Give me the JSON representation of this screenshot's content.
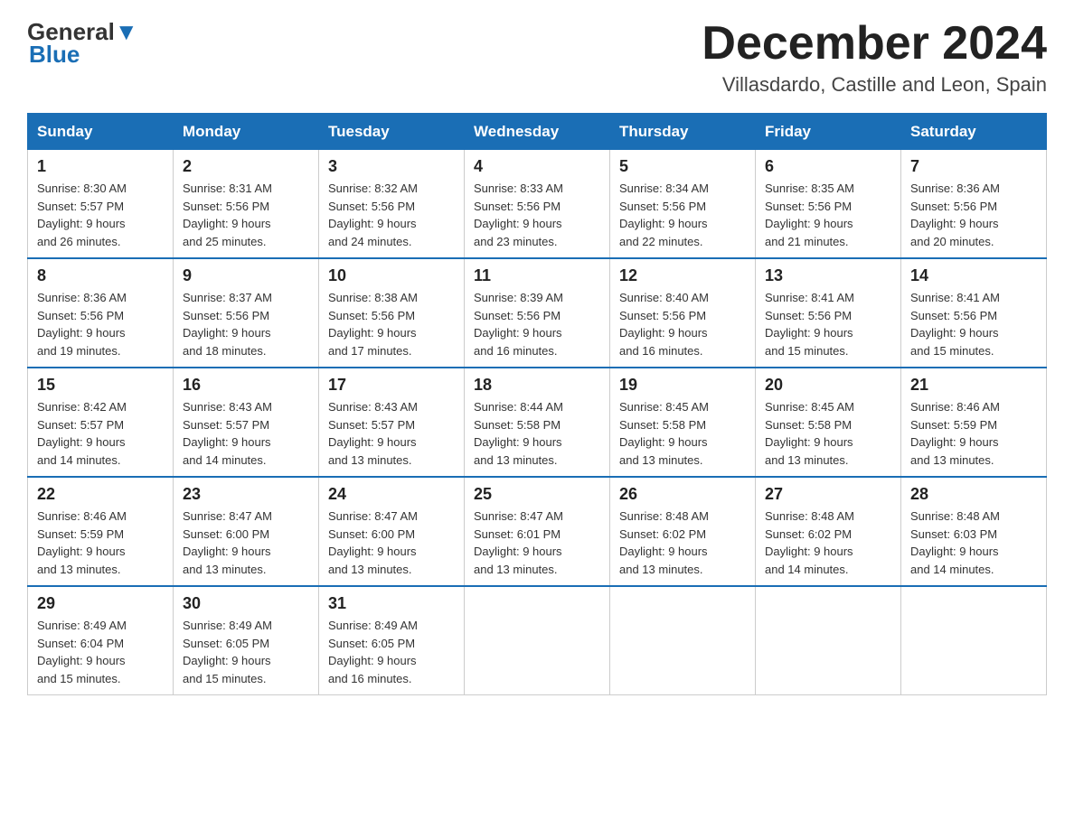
{
  "header": {
    "logo_top": "General",
    "logo_bottom": "Blue",
    "month_title": "December 2024",
    "location": "Villasdardo, Castille and Leon, Spain"
  },
  "days_of_week": [
    "Sunday",
    "Monday",
    "Tuesday",
    "Wednesday",
    "Thursday",
    "Friday",
    "Saturday"
  ],
  "weeks": [
    [
      {
        "day": "1",
        "sunrise": "8:30 AM",
        "sunset": "5:57 PM",
        "daylight": "9 hours and 26 minutes."
      },
      {
        "day": "2",
        "sunrise": "8:31 AM",
        "sunset": "5:56 PM",
        "daylight": "9 hours and 25 minutes."
      },
      {
        "day": "3",
        "sunrise": "8:32 AM",
        "sunset": "5:56 PM",
        "daylight": "9 hours and 24 minutes."
      },
      {
        "day": "4",
        "sunrise": "8:33 AM",
        "sunset": "5:56 PM",
        "daylight": "9 hours and 23 minutes."
      },
      {
        "day": "5",
        "sunrise": "8:34 AM",
        "sunset": "5:56 PM",
        "daylight": "9 hours and 22 minutes."
      },
      {
        "day": "6",
        "sunrise": "8:35 AM",
        "sunset": "5:56 PM",
        "daylight": "9 hours and 21 minutes."
      },
      {
        "day": "7",
        "sunrise": "8:36 AM",
        "sunset": "5:56 PM",
        "daylight": "9 hours and 20 minutes."
      }
    ],
    [
      {
        "day": "8",
        "sunrise": "8:36 AM",
        "sunset": "5:56 PM",
        "daylight": "9 hours and 19 minutes."
      },
      {
        "day": "9",
        "sunrise": "8:37 AM",
        "sunset": "5:56 PM",
        "daylight": "9 hours and 18 minutes."
      },
      {
        "day": "10",
        "sunrise": "8:38 AM",
        "sunset": "5:56 PM",
        "daylight": "9 hours and 17 minutes."
      },
      {
        "day": "11",
        "sunrise": "8:39 AM",
        "sunset": "5:56 PM",
        "daylight": "9 hours and 16 minutes."
      },
      {
        "day": "12",
        "sunrise": "8:40 AM",
        "sunset": "5:56 PM",
        "daylight": "9 hours and 16 minutes."
      },
      {
        "day": "13",
        "sunrise": "8:41 AM",
        "sunset": "5:56 PM",
        "daylight": "9 hours and 15 minutes."
      },
      {
        "day": "14",
        "sunrise": "8:41 AM",
        "sunset": "5:56 PM",
        "daylight": "9 hours and 15 minutes."
      }
    ],
    [
      {
        "day": "15",
        "sunrise": "8:42 AM",
        "sunset": "5:57 PM",
        "daylight": "9 hours and 14 minutes."
      },
      {
        "day": "16",
        "sunrise": "8:43 AM",
        "sunset": "5:57 PM",
        "daylight": "9 hours and 14 minutes."
      },
      {
        "day": "17",
        "sunrise": "8:43 AM",
        "sunset": "5:57 PM",
        "daylight": "9 hours and 13 minutes."
      },
      {
        "day": "18",
        "sunrise": "8:44 AM",
        "sunset": "5:58 PM",
        "daylight": "9 hours and 13 minutes."
      },
      {
        "day": "19",
        "sunrise": "8:45 AM",
        "sunset": "5:58 PM",
        "daylight": "9 hours and 13 minutes."
      },
      {
        "day": "20",
        "sunrise": "8:45 AM",
        "sunset": "5:58 PM",
        "daylight": "9 hours and 13 minutes."
      },
      {
        "day": "21",
        "sunrise": "8:46 AM",
        "sunset": "5:59 PM",
        "daylight": "9 hours and 13 minutes."
      }
    ],
    [
      {
        "day": "22",
        "sunrise": "8:46 AM",
        "sunset": "5:59 PM",
        "daylight": "9 hours and 13 minutes."
      },
      {
        "day": "23",
        "sunrise": "8:47 AM",
        "sunset": "6:00 PM",
        "daylight": "9 hours and 13 minutes."
      },
      {
        "day": "24",
        "sunrise": "8:47 AM",
        "sunset": "6:00 PM",
        "daylight": "9 hours and 13 minutes."
      },
      {
        "day": "25",
        "sunrise": "8:47 AM",
        "sunset": "6:01 PM",
        "daylight": "9 hours and 13 minutes."
      },
      {
        "day": "26",
        "sunrise": "8:48 AM",
        "sunset": "6:02 PM",
        "daylight": "9 hours and 13 minutes."
      },
      {
        "day": "27",
        "sunrise": "8:48 AM",
        "sunset": "6:02 PM",
        "daylight": "9 hours and 14 minutes."
      },
      {
        "day": "28",
        "sunrise": "8:48 AM",
        "sunset": "6:03 PM",
        "daylight": "9 hours and 14 minutes."
      }
    ],
    [
      {
        "day": "29",
        "sunrise": "8:49 AM",
        "sunset": "6:04 PM",
        "daylight": "9 hours and 15 minutes."
      },
      {
        "day": "30",
        "sunrise": "8:49 AM",
        "sunset": "6:05 PM",
        "daylight": "9 hours and 15 minutes."
      },
      {
        "day": "31",
        "sunrise": "8:49 AM",
        "sunset": "6:05 PM",
        "daylight": "9 hours and 16 minutes."
      },
      null,
      null,
      null,
      null
    ]
  ],
  "labels": {
    "sunrise": "Sunrise:",
    "sunset": "Sunset:",
    "daylight": "Daylight:"
  }
}
